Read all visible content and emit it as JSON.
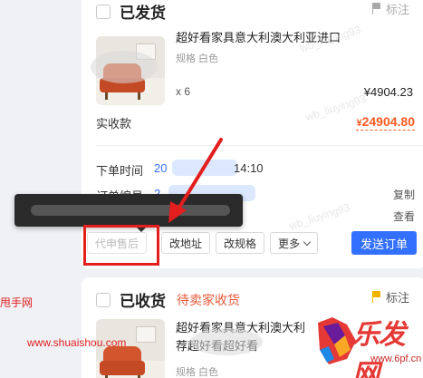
{
  "order1": {
    "status": "已发货",
    "mark_label": "标注",
    "product_title": "超好看家具意大利澳大利亚进口",
    "spec": "规格 白色",
    "quantity": "x 6",
    "unit_price": "¥4904.23",
    "paid_label": "实收款",
    "paid_currency": "¥",
    "paid_amount": "24904.80",
    "order_time_label": "下单时间",
    "order_time_year": "20",
    "order_time_clock": "14:10",
    "order_no_label": "订单编号",
    "order_no_prefix": "2",
    "copy_label": "复制",
    "view_label": "查看",
    "actions": {
      "after_sales": "代申售后",
      "change_address": "改地址",
      "change_spec": "改规格",
      "more": "更多",
      "send_order": "发送订单"
    }
  },
  "order2": {
    "status": "已收货",
    "sub_status": "待卖家收货",
    "mark_label": "标注",
    "product_title_line1": "超好看家具意大利澳大利",
    "product_title_line2": "荐超好看超好看",
    "spec": "规格 白色"
  },
  "watermarks": {
    "site_name": "甩手网",
    "site_url": "www.shuaishou.com",
    "overlay_id": "wb_liuying93",
    "logo_text": "乐发网",
    "logo_url": "www.6pf.cn"
  },
  "colors": {
    "accent_blue": "#3370ff",
    "amount_orange": "#ff5b22",
    "status_red": "#e5583a",
    "annotation_red": "#e41d1d"
  }
}
